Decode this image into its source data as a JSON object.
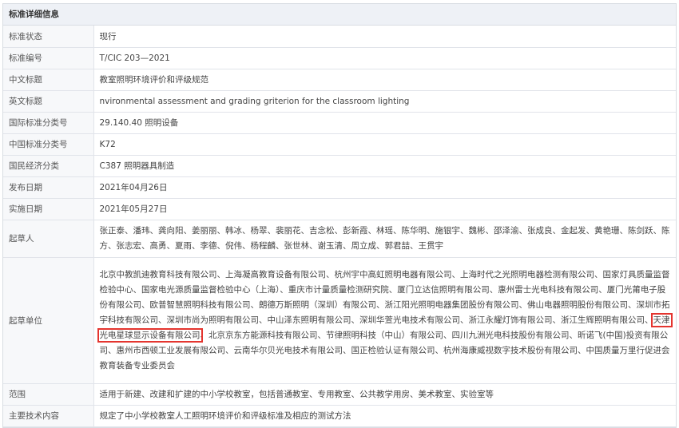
{
  "section_title": "标准详细信息",
  "rows": [
    {
      "label": "标准状态",
      "value": "现行"
    },
    {
      "label": "标准编号",
      "value": "T/CIC 203—2021"
    },
    {
      "label": "中文标题",
      "value": "教室照明环境评价和评级规范"
    },
    {
      "label": "英文标题",
      "value": "nvironmental assessment and grading griterion for the classroom lighting"
    },
    {
      "label": "国际标准分类号",
      "value": "29.140.40 照明设备"
    },
    {
      "label": "中国标准分类号",
      "value": "K72"
    },
    {
      "label": "国民经济分类",
      "value": "C387 照明器具制造"
    },
    {
      "label": "发布日期",
      "value": "2021年04月26日"
    },
    {
      "label": "实施日期",
      "value": "2021年05月27日"
    }
  ],
  "drafters": {
    "label": "起草人",
    "value": "张正泰、潘玮、龚向阳、姜丽丽、韩冰、杨翠、裴丽花、吉念松、彭新霞、林瑶、陈华明、施银宇、魏彬、邵泽渝、张成良、金起发、黄艳珊、陈剑跃、陈方、张志宏、高勇、夏雨、李德、倪伟、杨程麟、张世林、谢玉清、周立成、郭君喆、王贯宇"
  },
  "units": {
    "label": "起草单位",
    "before": "北京中教凯迪教育科技有限公司、上海凝高教育设备有限公司、杭州宇中高虹照明电器有限公司、上海时代之光照明电器检测有限公司、国家灯具质量监督检验中心、国家电光源质量监督检验中心（上海）、重庆市计量质量检测研究院、厦门立达信照明有限公司、惠州雷士光电科技有限公司、厦门光莆电子股份有限公司、欧普智慧照明科技有限公司、朗德万斯照明（深圳）有限公司、浙江阳光照明电器集团股份有限公司、佛山电器照明股份有限公司、深圳市拓宇科技有限公司、深圳市尚为照明有限公司、中山泽东照明有限公司、深圳华萱光电技术有限公司、浙江永耀灯饰有限公司、浙江生辉照明有限公司、",
    "highlighted": "天津光电星球显示设备有限公司",
    "after": "、北京京东方能源科技有限公司、节律照明科技（中山）有限公司、四川九洲光电科技股份有限公司、昕诺飞(中国)投资有限公司、惠州市西顿工业发展有限公司、云南华尔贝光电技术有限公司、国正检验认证有限公司、杭州海康威视数字技术股份有限公司、中国质量万里行促进会教育装备专业委员会"
  },
  "scope": {
    "label": "范围",
    "value": "适用于新建、改建和扩建的中小学校教室，包括普通教室、专用教室、公共教学用房、美术教室、实验室等"
  },
  "content": {
    "label": "主要技术内容",
    "value": "规定了中小学校教室人工照明环境评价和评级标准及相应的测试方法"
  },
  "colors": {
    "highlight_border": "#e4352f",
    "label_bg": "#f7f8fa",
    "header_bg": "#eef1f6"
  }
}
